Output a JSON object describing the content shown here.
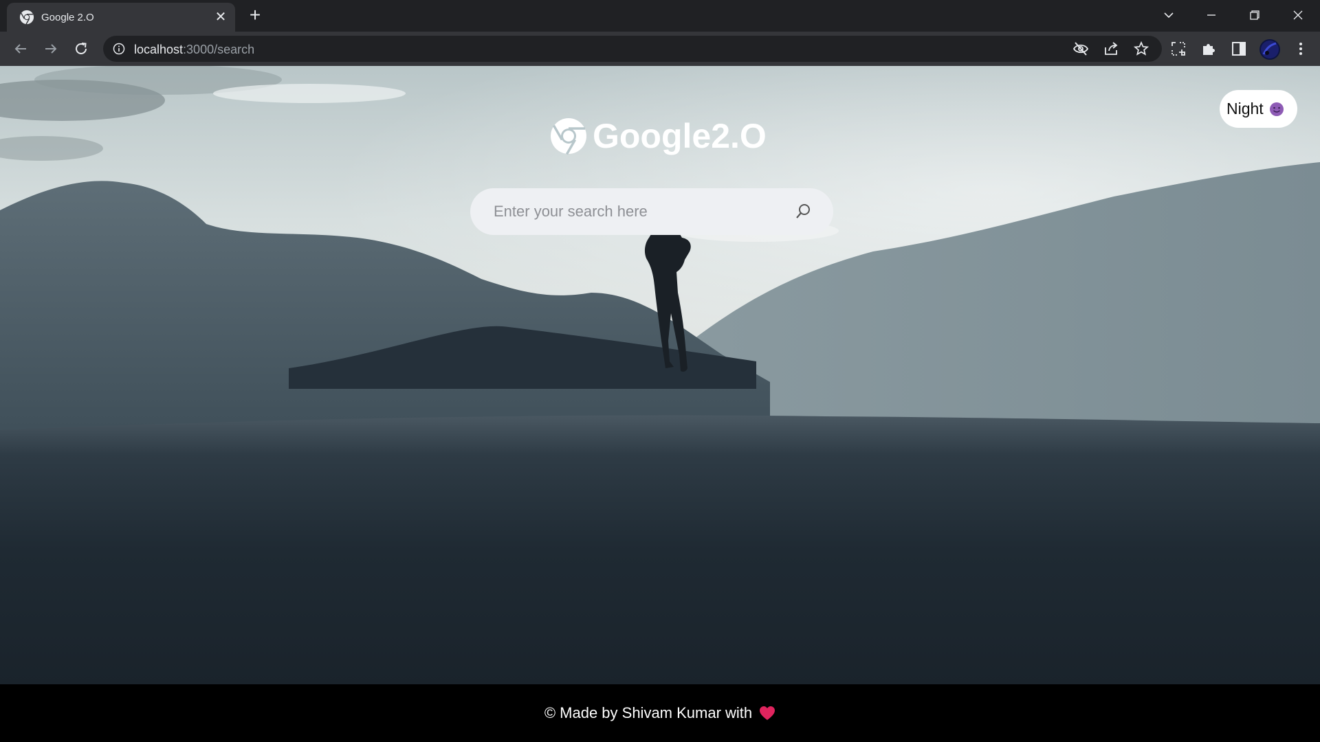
{
  "browser": {
    "tab_title": "Google 2.O",
    "tab_close": "✕",
    "new_tab": "+",
    "url_host": "localhost",
    "url_path": ":3000/search"
  },
  "page": {
    "night_toggle_label": "Night",
    "night_emoji_icon": "purple-smiling-face-icon",
    "logo_text": "Google2.O",
    "logo_icon": "chrome-logo-icon",
    "search_placeholder": "Enter your search here",
    "search_icon": "search-icon"
  },
  "footer": {
    "text": "© Made by Shivam Kumar with",
    "heart_icon": "red-heart-icon"
  },
  "colors": {
    "chrome_dark": "#202124",
    "chrome_toolbar": "#35363a",
    "footer_bg": "#000000",
    "search_bg": "#eef0f3",
    "heart": "#e0245e",
    "night_emoji": "#8e5bb5"
  }
}
